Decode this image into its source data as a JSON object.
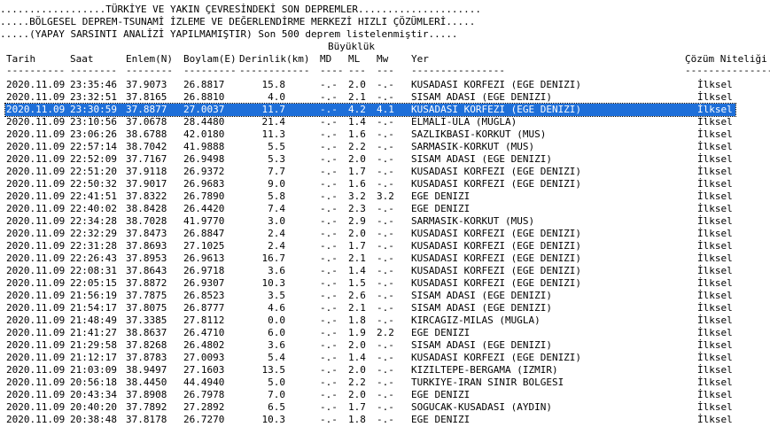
{
  "banner": {
    "line1": "..................TÜRKİYE VE YAKIN ÇEVRESİNDEKİ SON DEPREMLER.....................",
    "line2": ".....BÖLGESEL DEPREM-TSUNAMİ İZLEME VE DEĞERLENDİRME MERKEZİ HIZLI ÇÖZÜMLERİ.....",
    "line3": ".....(YAPAY SARSINTI ANALİZİ YAPILMAMIŞTIR) Son 500 deprem listelenmiştir....."
  },
  "columns": {
    "buyukluk": "Büyüklük",
    "tarih": "Tarih",
    "saat": "Saat",
    "enlem": "Enlem(N)",
    "boylam": "Boylam(E)",
    "derinlik": "Derinlik(km)",
    "md": "MD",
    "ml": "ML",
    "mw": "Mw",
    "yer": "Yer",
    "cozum": "Çözüm Niteliği"
  },
  "dashes": {
    "tarih": "----------",
    "saat": "--------",
    "enlem": "--------",
    "boylam": "---------",
    "derinlik": "------------",
    "md": "----",
    "ml": "---",
    "mw": "---",
    "yer": "----------------",
    "cozum": "-----------------"
  },
  "selected_index": 2,
  "rows": [
    {
      "tarih": "2020.11.09",
      "saat": "23:35:46",
      "enlem": "37.9073",
      "boylam": "26.8817",
      "derinlik": "15.8",
      "md": "-.-",
      "ml": "2.0",
      "mw": "-.-",
      "yer": "KUSADASI KORFEZI (EGE DENIZI)",
      "cozum": "İlksel"
    },
    {
      "tarih": "2020.11.09",
      "saat": "23:32:51",
      "enlem": "37.8165",
      "boylam": "26.8810",
      "derinlik": "4.0",
      "md": "-.-",
      "ml": "2.1",
      "mw": "-.-",
      "yer": "SISAM ADASI (EGE DENIZI)",
      "cozum": "İlksel"
    },
    {
      "tarih": "2020.11.09",
      "saat": "23:30:59",
      "enlem": "37.8877",
      "boylam": "27.0037",
      "derinlik": "11.7",
      "md": "-.-",
      "ml": "4.2",
      "mw": "4.1",
      "yer": "KUSADASI KORFEZI (EGE DENIZI)",
      "cozum": "İlksel"
    },
    {
      "tarih": "2020.11.09",
      "saat": "23:10:56",
      "enlem": "37.0678",
      "boylam": "28.4480",
      "derinlik": "21.4",
      "md": "-.-",
      "ml": "1.4",
      "mw": "-.-",
      "yer": "ELMALI-ULA (MUGLA)",
      "cozum": "İlksel"
    },
    {
      "tarih": "2020.11.09",
      "saat": "23:06:26",
      "enlem": "38.6788",
      "boylam": "42.0180",
      "derinlik": "11.3",
      "md": "-.-",
      "ml": "1.6",
      "mw": "-.-",
      "yer": "SAZLIKBASI-KORKUT (MUS)",
      "cozum": "İlksel"
    },
    {
      "tarih": "2020.11.09",
      "saat": "22:57:14",
      "enlem": "38.7042",
      "boylam": "41.9888",
      "derinlik": "5.5",
      "md": "-.-",
      "ml": "2.2",
      "mw": "-.-",
      "yer": "SARMASIK-KORKUT (MUS)",
      "cozum": "İlksel"
    },
    {
      "tarih": "2020.11.09",
      "saat": "22:52:09",
      "enlem": "37.7167",
      "boylam": "26.9498",
      "derinlik": "5.3",
      "md": "-.-",
      "ml": "2.0",
      "mw": "-.-",
      "yer": "SISAM ADASI (EGE DENIZI)",
      "cozum": "İlksel"
    },
    {
      "tarih": "2020.11.09",
      "saat": "22:51:20",
      "enlem": "37.9118",
      "boylam": "26.9372",
      "derinlik": "7.7",
      "md": "-.-",
      "ml": "1.7",
      "mw": "-.-",
      "yer": "KUSADASI KORFEZI (EGE DENIZI)",
      "cozum": "İlksel"
    },
    {
      "tarih": "2020.11.09",
      "saat": "22:50:32",
      "enlem": "37.9017",
      "boylam": "26.9683",
      "derinlik": "9.0",
      "md": "-.-",
      "ml": "1.6",
      "mw": "-.-",
      "yer": "KUSADASI KORFEZI (EGE DENIZI)",
      "cozum": "İlksel"
    },
    {
      "tarih": "2020.11.09",
      "saat": "22:41:51",
      "enlem": "37.8322",
      "boylam": "26.7890",
      "derinlik": "5.8",
      "md": "-.-",
      "ml": "3.2",
      "mw": "3.2",
      "yer": "EGE DENIZI",
      "cozum": "İlksel"
    },
    {
      "tarih": "2020.11.09",
      "saat": "22:40:02",
      "enlem": "38.8428",
      "boylam": "26.4420",
      "derinlik": "7.4",
      "md": "-.-",
      "ml": "2.3",
      "mw": "-.-",
      "yer": "EGE DENIZI",
      "cozum": "İlksel"
    },
    {
      "tarih": "2020.11.09",
      "saat": "22:34:28",
      "enlem": "38.7028",
      "boylam": "41.9770",
      "derinlik": "3.0",
      "md": "-.-",
      "ml": "2.9",
      "mw": "-.-",
      "yer": "SARMASIK-KORKUT (MUS)",
      "cozum": "İlksel"
    },
    {
      "tarih": "2020.11.09",
      "saat": "22:32:29",
      "enlem": "37.8473",
      "boylam": "26.8847",
      "derinlik": "2.4",
      "md": "-.-",
      "ml": "2.0",
      "mw": "-.-",
      "yer": "KUSADASI KORFEZI (EGE DENIZI)",
      "cozum": "İlksel"
    },
    {
      "tarih": "2020.11.09",
      "saat": "22:31:28",
      "enlem": "37.8693",
      "boylam": "27.1025",
      "derinlik": "2.4",
      "md": "-.-",
      "ml": "1.7",
      "mw": "-.-",
      "yer": "KUSADASI KORFEZI (EGE DENIZI)",
      "cozum": "İlksel"
    },
    {
      "tarih": "2020.11.09",
      "saat": "22:26:43",
      "enlem": "37.8953",
      "boylam": "26.9613",
      "derinlik": "16.7",
      "md": "-.-",
      "ml": "2.1",
      "mw": "-.-",
      "yer": "KUSADASI KORFEZI (EGE DENIZI)",
      "cozum": "İlksel"
    },
    {
      "tarih": "2020.11.09",
      "saat": "22:08:31",
      "enlem": "37.8643",
      "boylam": "26.9718",
      "derinlik": "3.6",
      "md": "-.-",
      "ml": "1.4",
      "mw": "-.-",
      "yer": "KUSADASI KORFEZI (EGE DENIZI)",
      "cozum": "İlksel"
    },
    {
      "tarih": "2020.11.09",
      "saat": "22:05:15",
      "enlem": "37.8872",
      "boylam": "26.9307",
      "derinlik": "10.3",
      "md": "-.-",
      "ml": "1.5",
      "mw": "-.-",
      "yer": "KUSADASI KORFEZI (EGE DENIZI)",
      "cozum": "İlksel"
    },
    {
      "tarih": "2020.11.09",
      "saat": "21:56:19",
      "enlem": "37.7875",
      "boylam": "26.8523",
      "derinlik": "3.5",
      "md": "-.-",
      "ml": "2.6",
      "mw": "-.-",
      "yer": "SISAM ADASI (EGE DENIZI)",
      "cozum": "İlksel"
    },
    {
      "tarih": "2020.11.09",
      "saat": "21:54:17",
      "enlem": "37.8075",
      "boylam": "26.8777",
      "derinlik": "4.6",
      "md": "-.-",
      "ml": "2.1",
      "mw": "-.-",
      "yer": "SISAM ADASI (EGE DENIZI)",
      "cozum": "İlksel"
    },
    {
      "tarih": "2020.11.09",
      "saat": "21:48:49",
      "enlem": "37.3385",
      "boylam": "27.8112",
      "derinlik": "0.0",
      "md": "-.-",
      "ml": "1.8",
      "mw": "-.-",
      "yer": "KIRCAGIZ-MILAS (MUGLA)",
      "cozum": "İlksel"
    },
    {
      "tarih": "2020.11.09",
      "saat": "21:41:27",
      "enlem": "38.8637",
      "boylam": "26.4710",
      "derinlik": "6.0",
      "md": "-.-",
      "ml": "1.9",
      "mw": "2.2",
      "yer": "EGE DENIZI",
      "cozum": "İlksel"
    },
    {
      "tarih": "2020.11.09",
      "saat": "21:29:58",
      "enlem": "37.8268",
      "boylam": "26.4802",
      "derinlik": "3.6",
      "md": "-.-",
      "ml": "2.0",
      "mw": "-.-",
      "yer": "SISAM ADASI (EGE DENIZI)",
      "cozum": "İlksel"
    },
    {
      "tarih": "2020.11.09",
      "saat": "21:12:17",
      "enlem": "37.8783",
      "boylam": "27.0093",
      "derinlik": "5.4",
      "md": "-.-",
      "ml": "1.4",
      "mw": "-.-",
      "yer": "KUSADASI KORFEZI (EGE DENIZI)",
      "cozum": "İlksel"
    },
    {
      "tarih": "2020.11.09",
      "saat": "21:03:09",
      "enlem": "38.9497",
      "boylam": "27.1603",
      "derinlik": "13.5",
      "md": "-.-",
      "ml": "2.0",
      "mw": "-.-",
      "yer": "KIZILTEPE-BERGAMA (IZMIR)",
      "cozum": "İlksel"
    },
    {
      "tarih": "2020.11.09",
      "saat": "20:56:18",
      "enlem": "38.4450",
      "boylam": "44.4940",
      "derinlik": "5.0",
      "md": "-.-",
      "ml": "2.2",
      "mw": "-.-",
      "yer": "TURKIYE-IRAN SINIR BOLGESI",
      "cozum": "İlksel"
    },
    {
      "tarih": "2020.11.09",
      "saat": "20:43:34",
      "enlem": "37.8908",
      "boylam": "26.7978",
      "derinlik": "7.0",
      "md": "-.-",
      "ml": "2.0",
      "mw": "-.-",
      "yer": "EGE DENIZI",
      "cozum": "İlksel"
    },
    {
      "tarih": "2020.11.09",
      "saat": "20:40:20",
      "enlem": "37.7892",
      "boylam": "27.2892",
      "derinlik": "6.5",
      "md": "-.-",
      "ml": "1.7",
      "mw": "-.-",
      "yer": "SOGUCAK-KUSADASI (AYDIN)",
      "cozum": "İlksel"
    },
    {
      "tarih": "2020.11.09",
      "saat": "20:38:48",
      "enlem": "37.8178",
      "boylam": "26.7270",
      "derinlik": "10.3",
      "md": "-.-",
      "ml": "1.8",
      "mw": "-.-",
      "yer": "EGE DENIZI",
      "cozum": "İlksel"
    }
  ]
}
